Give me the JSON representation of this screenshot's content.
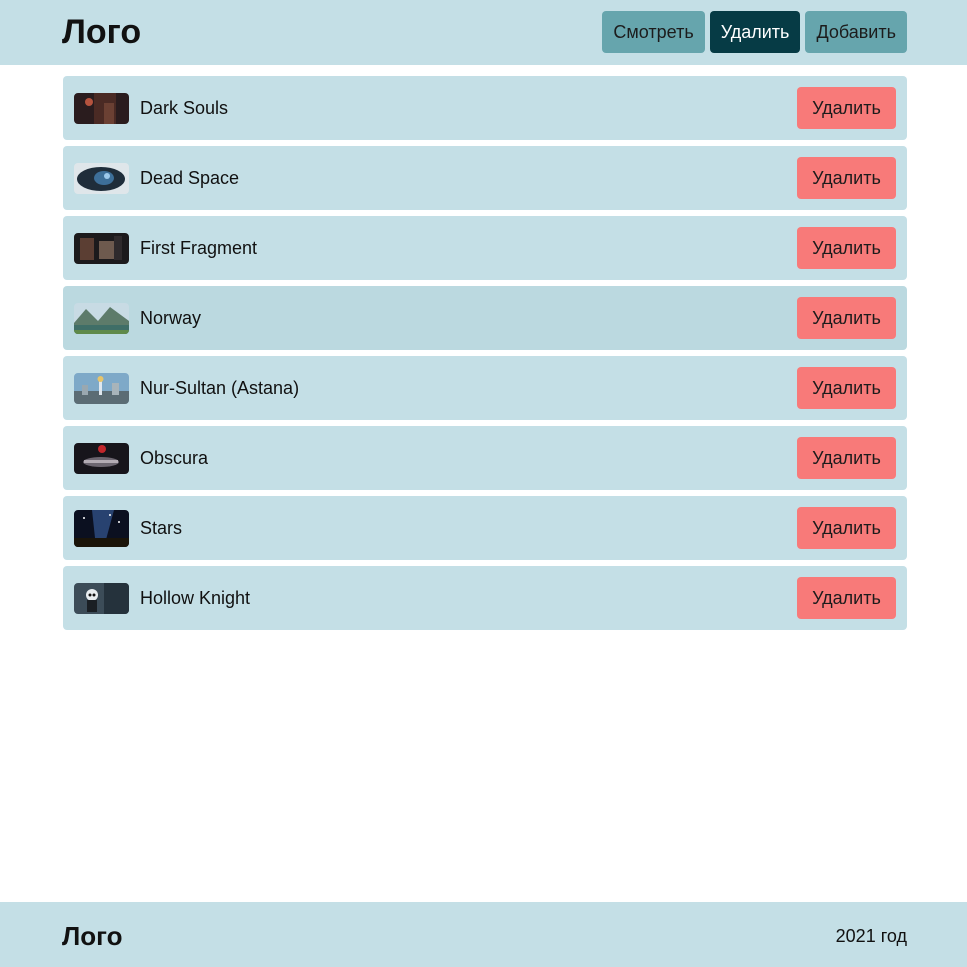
{
  "header": {
    "logo": "Лого",
    "nav": [
      {
        "label": "Смотреть",
        "active": false
      },
      {
        "label": "Удалить",
        "active": true
      },
      {
        "label": "Добавить",
        "active": false
      }
    ]
  },
  "items": [
    {
      "title": "Dark Souls",
      "delete_label": "Удалить"
    },
    {
      "title": "Dead Space",
      "delete_label": "Удалить"
    },
    {
      "title": "First Fragment",
      "delete_label": "Удалить"
    },
    {
      "title": "Norway",
      "delete_label": "Удалить"
    },
    {
      "title": "Nur-Sultan (Astana)",
      "delete_label": "Удалить"
    },
    {
      "title": "Obscura",
      "delete_label": "Удалить"
    },
    {
      "title": "Stars",
      "delete_label": "Удалить"
    },
    {
      "title": "Hollow Knight",
      "delete_label": "Удалить"
    }
  ],
  "footer": {
    "logo": "Лого",
    "year": "2021 год"
  },
  "colors": {
    "header_bg": "#c4dfe6",
    "nav_button": "#66a5ad",
    "nav_active": "#063b45",
    "delete_button": "#f87a79"
  }
}
